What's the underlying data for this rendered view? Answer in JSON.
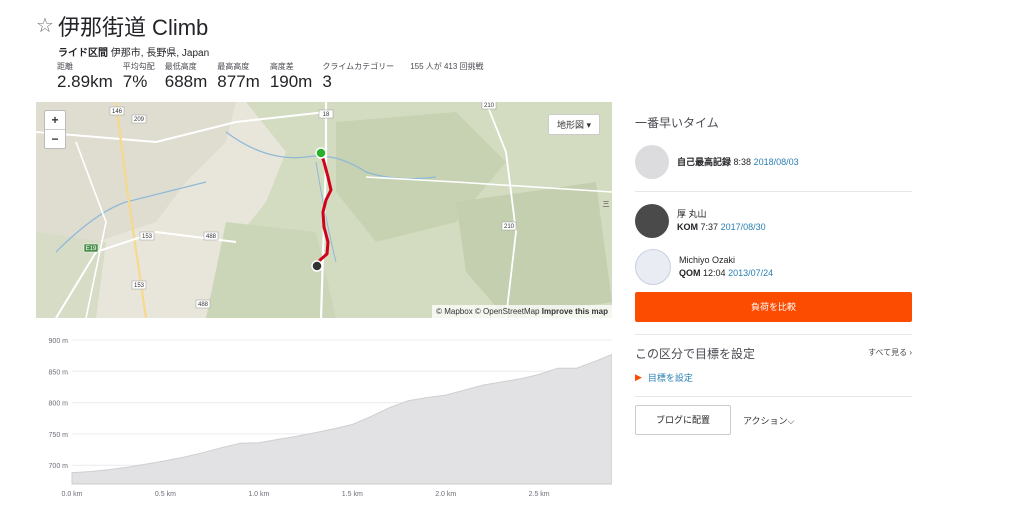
{
  "segment": {
    "title": "伊那街道 Climb",
    "type": "ライド区間",
    "location": "伊那市, 長野県, Japan"
  },
  "stats": [
    {
      "label": "距離",
      "value": "2.89km"
    },
    {
      "label": "平均勾配",
      "value": "7%"
    },
    {
      "label": "最低高度",
      "value": "688m"
    },
    {
      "label": "最高高度",
      "value": "877m"
    },
    {
      "label": "高度差",
      "value": "190m"
    },
    {
      "label": "クライムカテゴリー",
      "value": "3"
    }
  ],
  "attempts": "155 人が 413 回挑戦",
  "map": {
    "zoom_in": "+",
    "zoom_out": "−",
    "map_type": "地形図 ▾",
    "attribution_prefix": "© Mapbox © OpenStreetMap",
    "attribution_link": "Improve this map",
    "road_labels": [
      "146",
      "209",
      "18",
      "210",
      "153",
      "488",
      "153",
      "488",
      "210",
      "E19"
    ],
    "edge_label": "三"
  },
  "elevation": {
    "y_ticks": [
      "900 m",
      "850 m",
      "800 m",
      "750 m",
      "700 m"
    ],
    "x_ticks": [
      "0.0 km",
      "0.5 km",
      "1.0 km",
      "1.5 km",
      "2.0 km",
      "2.5 km"
    ],
    "profile_km": [
      0,
      0.1,
      0.2,
      0.3,
      0.4,
      0.5,
      0.6,
      0.7,
      0.8,
      0.9,
      1.0,
      1.1,
      1.2,
      1.3,
      1.4,
      1.5,
      1.6,
      1.7,
      1.8,
      1.9,
      2.0,
      2.1,
      2.2,
      2.3,
      2.4,
      2.5,
      2.6,
      2.7,
      2.8,
      2.89
    ],
    "profile_m": [
      688,
      690,
      693,
      697,
      702,
      707,
      713,
      720,
      728,
      735,
      736,
      741,
      746,
      752,
      758,
      765,
      778,
      792,
      803,
      808,
      812,
      820,
      828,
      833,
      838,
      845,
      855,
      855,
      866,
      877
    ]
  },
  "sidebar": {
    "fastest_heading": "一番早いタイム",
    "pr": {
      "label": "自己最高記録",
      "time": "8:38",
      "date": "2018/08/03"
    },
    "kom": {
      "name": "厚 丸山",
      "label": "KOM",
      "time": "7:37",
      "date": "2017/08/30"
    },
    "qom": {
      "name": "Michiyo Ozaki",
      "label": "QOM",
      "time": "12:04",
      "date": "2013/07/24"
    },
    "compare_button": "負荷を比較",
    "goal_heading": "この区分で目標を設定",
    "see_all": "すべて見る ›",
    "set_goal": "目標を設定",
    "blog_button": "ブログに配置",
    "actions": "アクション⌵"
  },
  "colors": {
    "accent": "#fc4c02",
    "link": "#2a7fb3",
    "route": "#d0021b"
  }
}
